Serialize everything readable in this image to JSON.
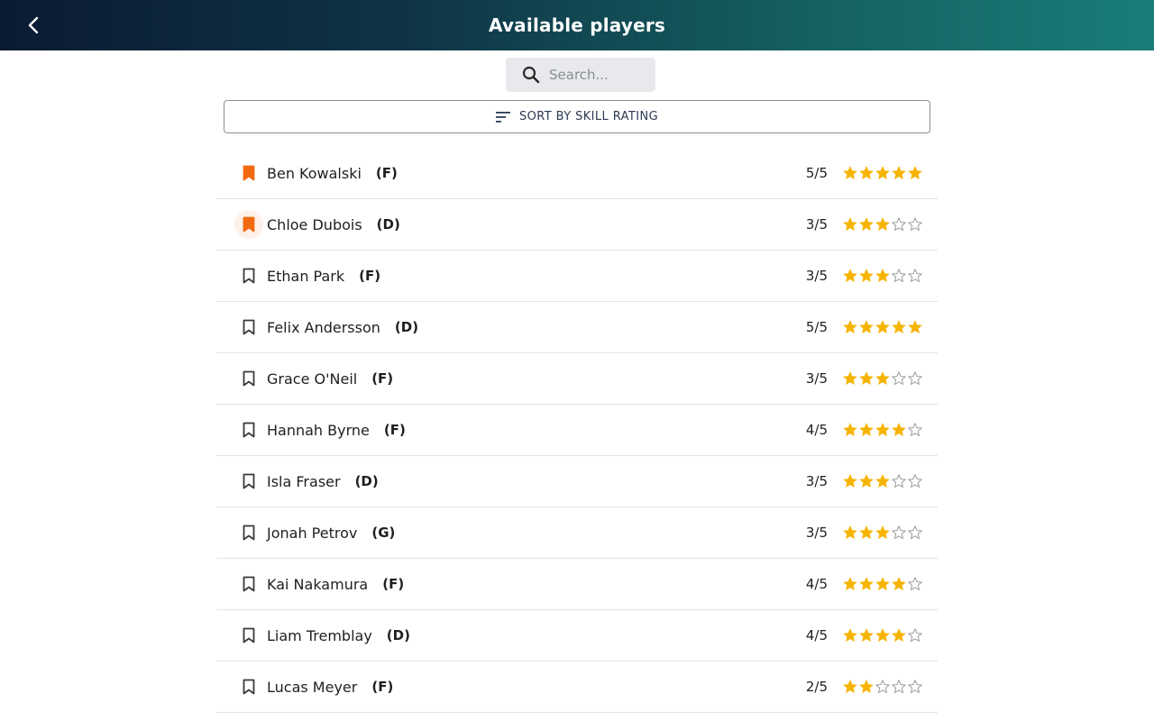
{
  "header": {
    "title": "Available players",
    "back_icon": "chevron-left-icon"
  },
  "search": {
    "placeholder": "Search...",
    "value": "",
    "icon": "search-icon"
  },
  "sort": {
    "label": "SORT BY SKILL RATING",
    "icon": "sort-icon"
  },
  "colors": {
    "accent": "#f26a10",
    "star": "#f6b400",
    "star_empty": "#9a9a9a",
    "header_start": "#0b1a33",
    "header_end": "#1a7d78"
  },
  "players": [
    {
      "name": "Ben Kowalski",
      "position": "(F)",
      "rating_text": "5/5",
      "rating": 5,
      "bookmarked": true
    },
    {
      "name": "Chloe Dubois",
      "position": "(D)",
      "rating_text": "3/5",
      "rating": 3,
      "bookmarked": true
    },
    {
      "name": "Ethan Park",
      "position": "(F)",
      "rating_text": "3/5",
      "rating": 3,
      "bookmarked": false
    },
    {
      "name": "Felix Andersson",
      "position": "(D)",
      "rating_text": "5/5",
      "rating": 5,
      "bookmarked": false
    },
    {
      "name": "Grace O'Neil",
      "position": "(F)",
      "rating_text": "3/5",
      "rating": 3,
      "bookmarked": false
    },
    {
      "name": "Hannah Byrne",
      "position": "(F)",
      "rating_text": "4/5",
      "rating": 4,
      "bookmarked": false
    },
    {
      "name": "Isla Fraser",
      "position": "(D)",
      "rating_text": "3/5",
      "rating": 3,
      "bookmarked": false
    },
    {
      "name": "Jonah Petrov",
      "position": "(G)",
      "rating_text": "3/5",
      "rating": 3,
      "bookmarked": false
    },
    {
      "name": "Kai Nakamura",
      "position": "(F)",
      "rating_text": "4/5",
      "rating": 4,
      "bookmarked": false
    },
    {
      "name": "Liam Tremblay",
      "position": "(D)",
      "rating_text": "4/5",
      "rating": 4,
      "bookmarked": false
    },
    {
      "name": "Lucas Meyer",
      "position": "(F)",
      "rating_text": "2/5",
      "rating": 2,
      "bookmarked": false
    }
  ]
}
